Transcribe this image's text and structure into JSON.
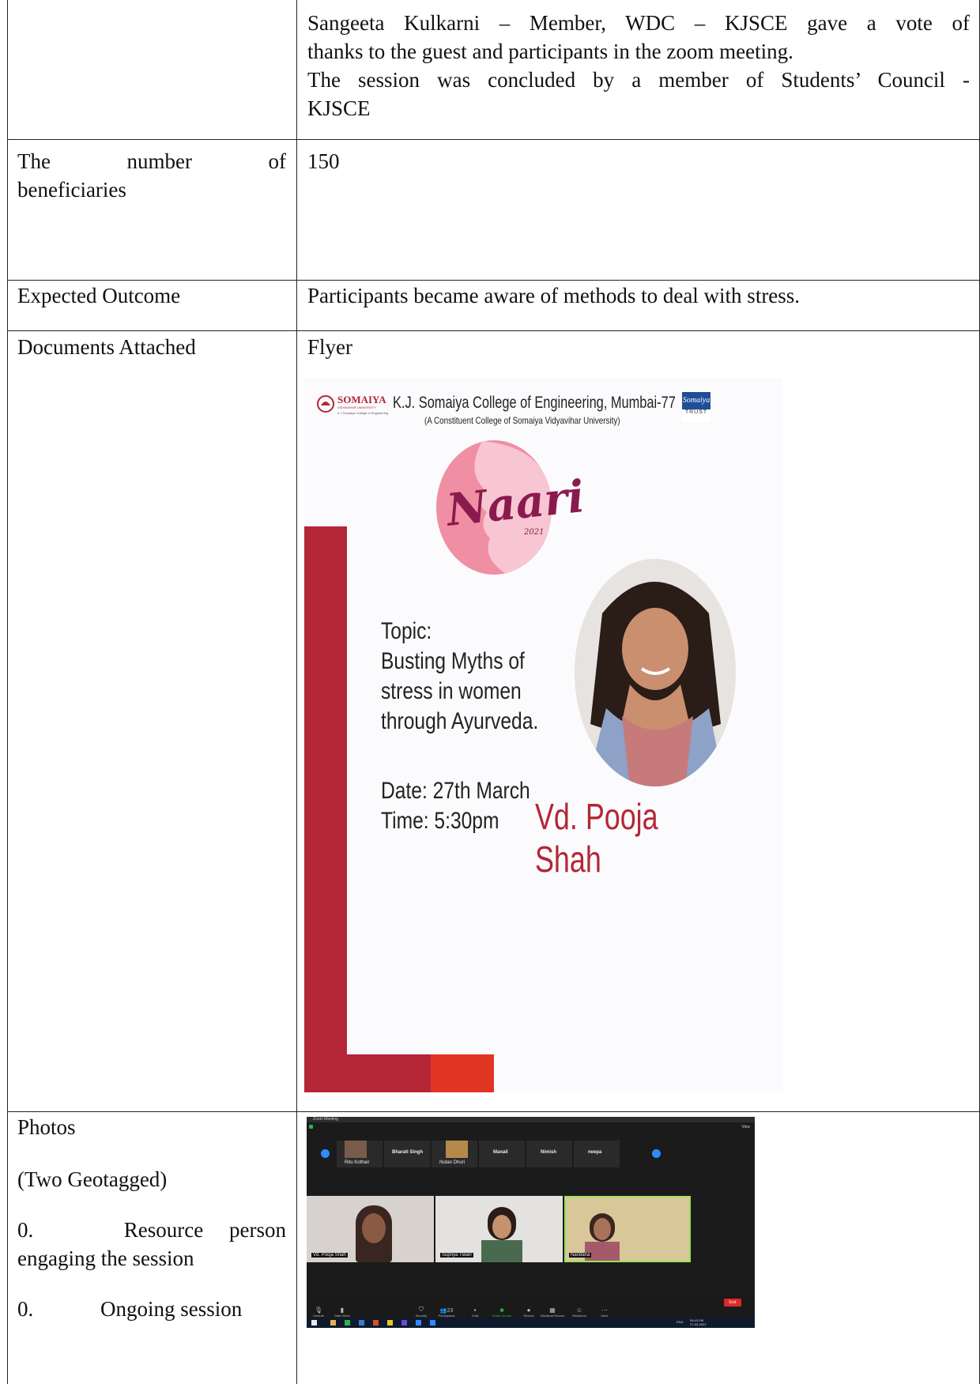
{
  "rows": {
    "top": {
      "line1": "Sangeeta Kulkarni – Member, WDC – KJSCE gave a vote of",
      "line2": "thanks to the guest and participants in the zoom meeting.",
      "line3": "The session was concluded by a member of Students’ Council -",
      "line4": "KJSCE"
    },
    "beneficiaries": {
      "label_w1": "The",
      "label_w2": "number",
      "label_w3": "of",
      "label_line2": "beneficiaries",
      "value": "150"
    },
    "outcome": {
      "label": "Expected Outcome",
      "value": "Participants became aware of methods to deal with stress."
    },
    "documents": {
      "label": "Documents Attached",
      "value": "Flyer"
    },
    "photos": {
      "label": "Photos",
      "sub": "(Two Geotagged)",
      "item1_num": "0.",
      "item1_line1": "Resource person",
      "item1_line2": "engaging the session",
      "item2_num": "0.",
      "item2_text": "Ongoing session"
    }
  },
  "flyer": {
    "logo_main": "SOMAIYA",
    "logo_sub": "VIDYAVIHAR UNIVERSITY",
    "logo_sub2": "K J Somaiya College of Engineering",
    "college": "K.J. Somaiya College of Engineering, Mumbai-77",
    "college_sub": "(A Constituent College of Somaiya Vidyavihar University)",
    "trust_script": "Somaiya",
    "trust_word": "TRUST",
    "event_name": "Naari",
    "event_year": "2021",
    "topic_label": "Topic:",
    "topic_l1": "Busting Myths of",
    "topic_l2": "stress in women",
    "topic_l3": "through Ayurveda.",
    "date": "Date: 27th March",
    "time": "Time: 5:30pm",
    "speaker": "Vd. Pooja Shah",
    "colors": {
      "red": "#b42636",
      "orange": "#e03522",
      "pink": "#ef8fa5"
    }
  },
  "zoom": {
    "title": "Zoom Meeting",
    "view": "View",
    "thumbs": [
      "Ritu Kothari",
      "Bharati Singh",
      "Nutan Dhuri",
      "Manali",
      "Nimish",
      "neepa"
    ],
    "tiles": [
      "Vd. Pooja Shah",
      "Supriya Tiwari",
      "Nandana"
    ],
    "toolbar": [
      "Unmute",
      "Start Video",
      "Security",
      "Participants",
      "Chat",
      "Share Screen",
      "Record",
      "Breakout Rooms",
      "Reactions",
      "More"
    ],
    "participants_count": "23",
    "end": "End",
    "clock_time": "05:43 PM",
    "clock_date": "27-03-2021",
    "lang": "ENG"
  }
}
